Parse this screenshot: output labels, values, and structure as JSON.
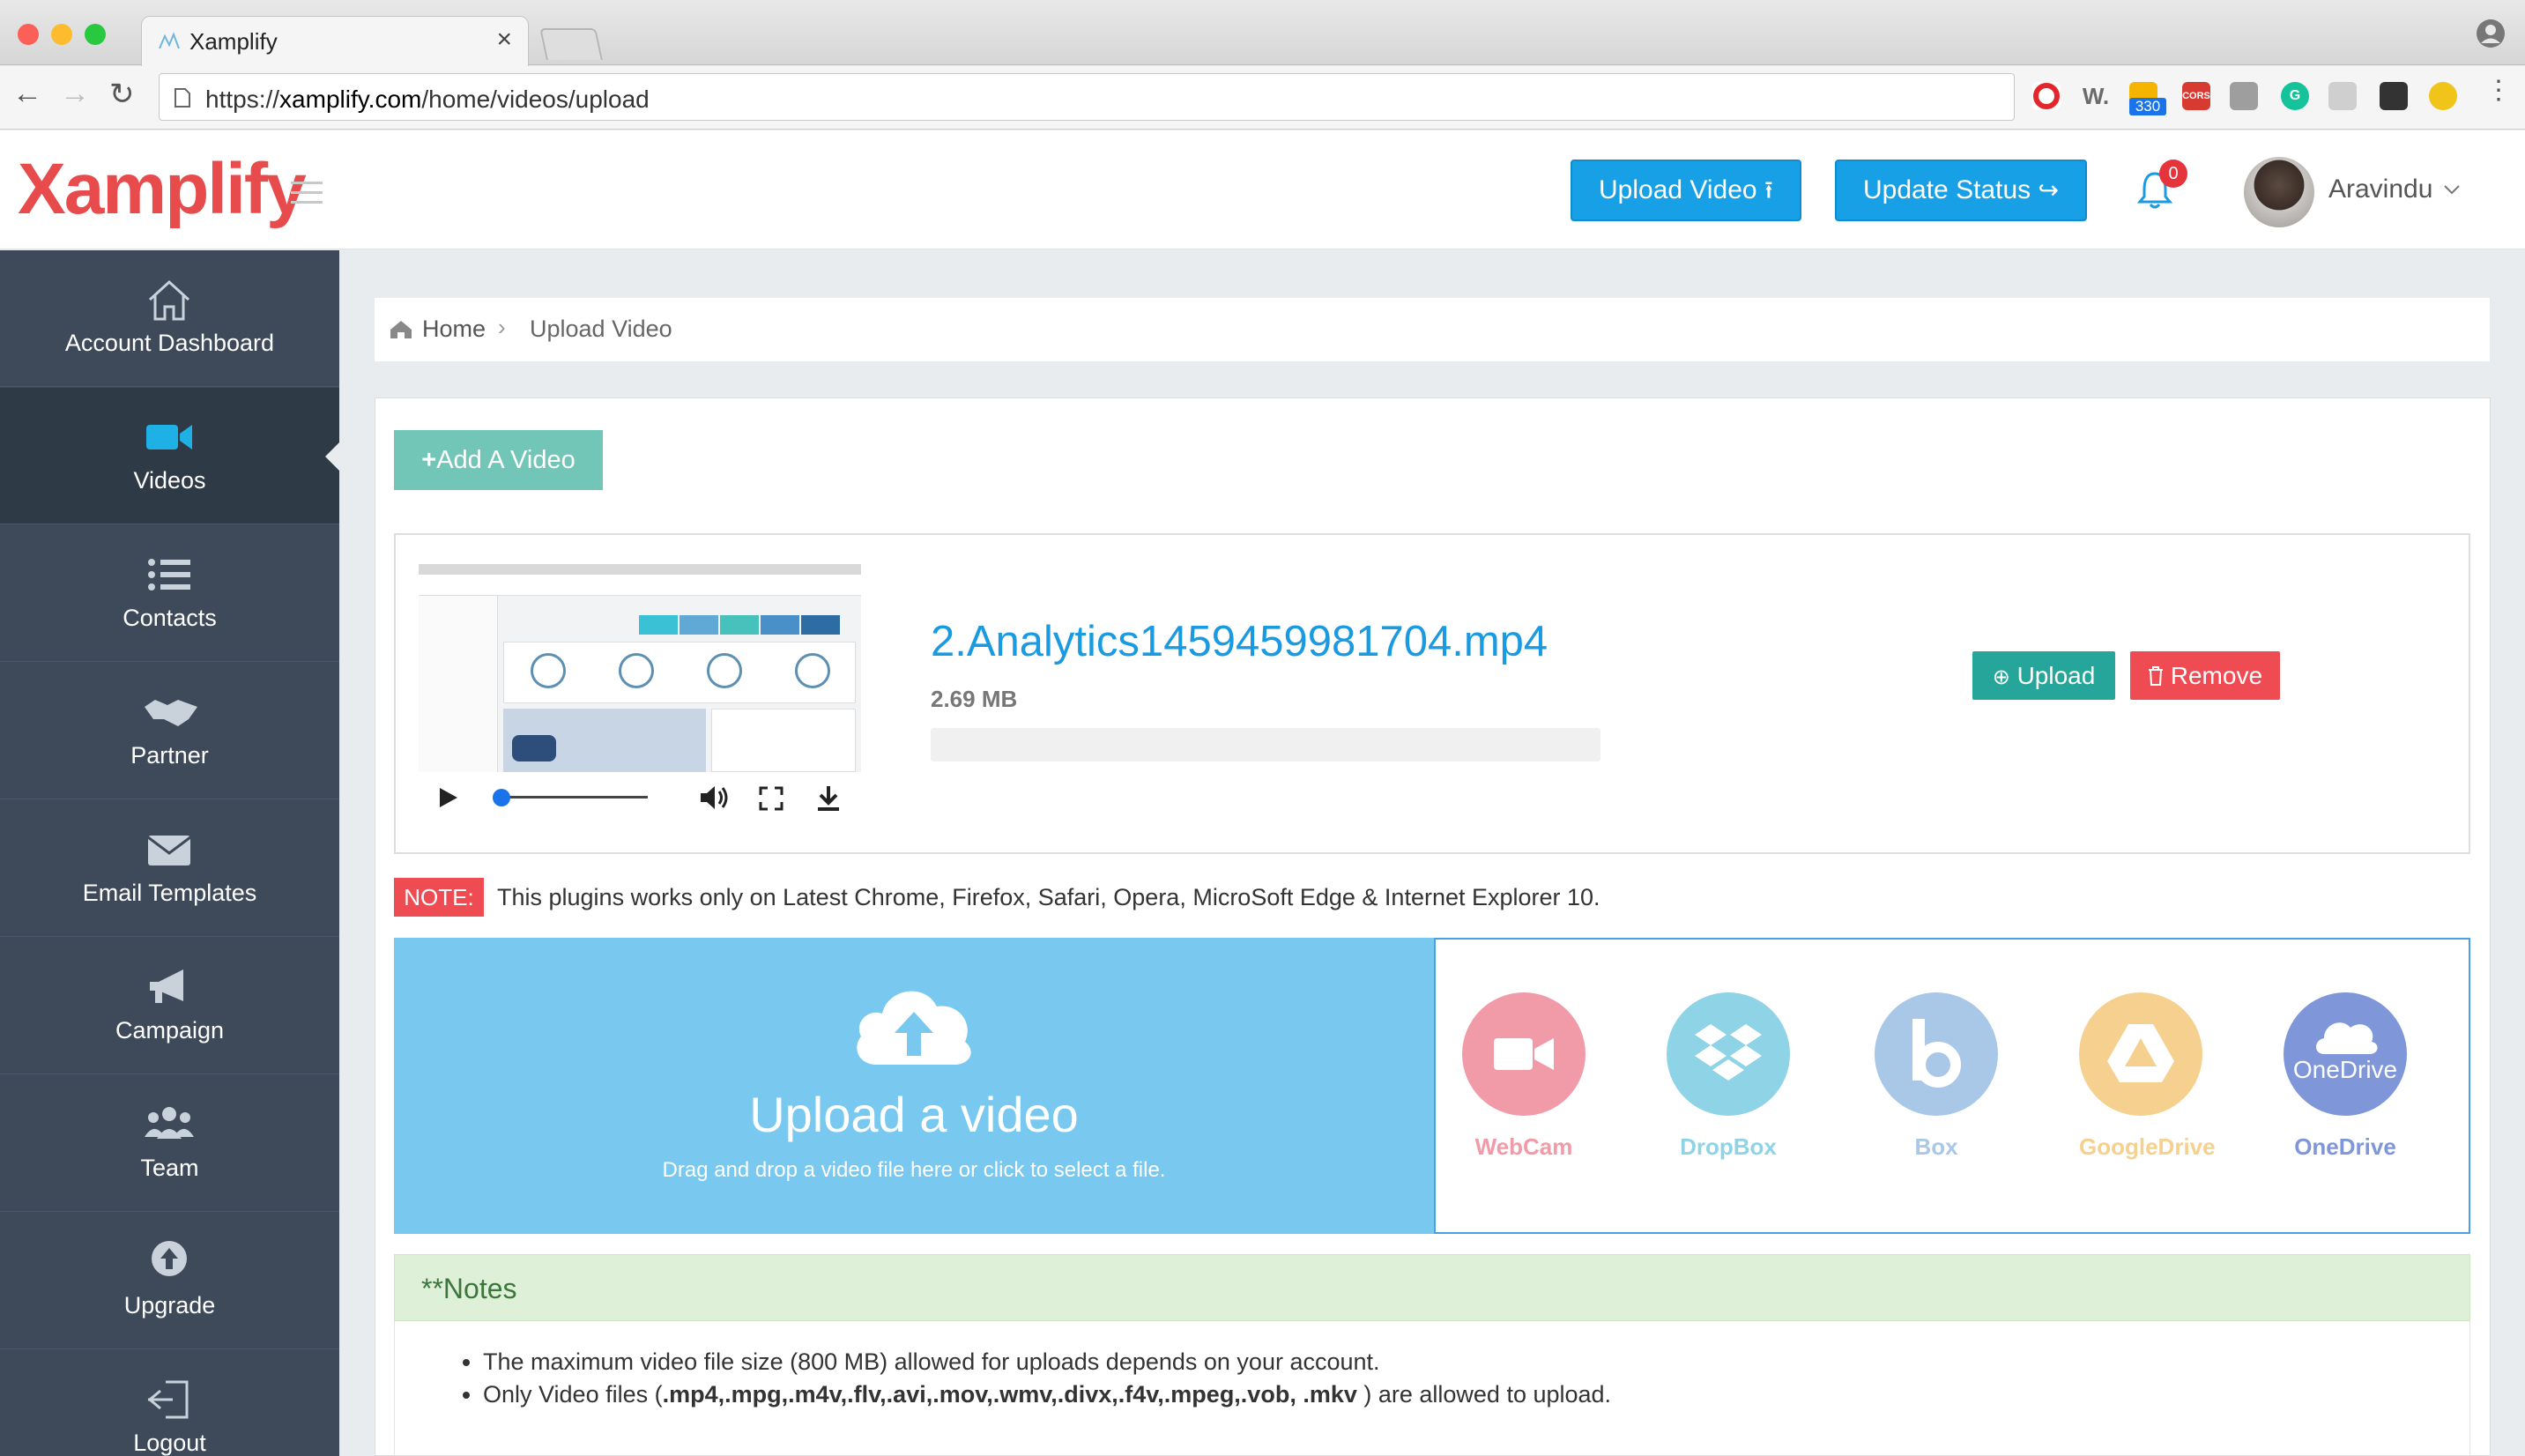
{
  "browser": {
    "tab_title": "Xamplify",
    "tab_close": "×",
    "url_prefix": "https://",
    "url_domain": "xamplify.com",
    "url_path": "/home/videos/upload",
    "ext_badge": "330",
    "ext_cors": "CORS"
  },
  "header": {
    "logo_x": "X",
    "logo_am": "am",
    "logo_plify": "plify",
    "upload_video_label": "Upload Video",
    "update_status_label": "Update Status",
    "notification_count": "0",
    "user_name": "Aravindu"
  },
  "sidebar": {
    "items": [
      {
        "label": "Account Dashboard",
        "icon": "home-icon"
      },
      {
        "label": "Videos",
        "icon": "video-camera-icon"
      },
      {
        "label": "Contacts",
        "icon": "list-icon"
      },
      {
        "label": "Partner",
        "icon": "handshake-icon"
      },
      {
        "label": "Email Templates",
        "icon": "envelope-icon"
      },
      {
        "label": "Campaign",
        "icon": "megaphone-icon"
      },
      {
        "label": "Team",
        "icon": "users-icon"
      },
      {
        "label": "Upgrade",
        "icon": "arrow-circle-up-icon"
      },
      {
        "label": "Logout",
        "icon": "sign-out-icon"
      }
    ]
  },
  "breadcrumb": {
    "home": "Home",
    "current": "Upload Video"
  },
  "add_video_label": "Add A Video",
  "video": {
    "file_name": "2.Analytics1459459981704.mp4",
    "file_size": "2.69 MB",
    "upload_progress": 0,
    "upload_label": "Upload",
    "remove_label": "Remove",
    "player_progress": 0
  },
  "note": {
    "label": "NOTE:",
    "text": "This plugins works only on Latest Chrome, Firefox, Safari, Opera, MicroSoft Edge & Internet Explorer 10."
  },
  "dropzone": {
    "title": "Upload a video",
    "subtitle": "Drag and drop a video file here or click to select a file."
  },
  "providers": [
    {
      "label": "WebCam",
      "color": "#f19aa8"
    },
    {
      "label": "DropBox",
      "color": "#8fd3e6"
    },
    {
      "label": "Box",
      "color": "#a9c8e8"
    },
    {
      "label": "GoogleDrive",
      "color": "#f5d08f"
    },
    {
      "label": "OneDrive",
      "color": "#7f97d9",
      "inner_text": "OneDrive"
    }
  ],
  "notes": {
    "title": "**Notes",
    "item1": "The maximum video file size (800 MB) allowed for uploads depends on your account.",
    "item2_pre": "Only Video files (",
    "item2_bold": ".mp4,.mpg,.m4v,.flv,.avi,.mov,.wmv,.divx,.f4v,.mpeg,.vob, .mkv",
    "item2_post": " ) are allowed to upload."
  },
  "colors": {
    "accent": "#17a0e6",
    "sidebar": "#3e4a59",
    "danger": "#ef4b53",
    "success": "#26a69a",
    "teal_button": "#72c6b7",
    "dropzone": "#78c8ef"
  }
}
